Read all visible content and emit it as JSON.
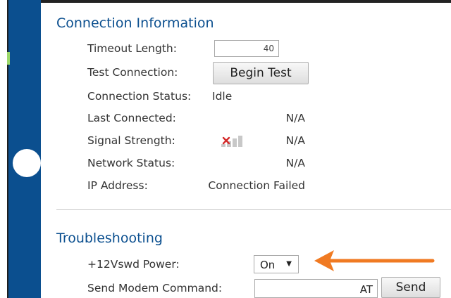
{
  "connection": {
    "title": "Connection Information",
    "timeout_label": "Timeout Length:",
    "timeout_value": "40",
    "test_label": "Test Connection:",
    "begin_test": "Begin Test",
    "status_label": "Connection Status:",
    "status_value": "Idle",
    "last_connected_label": "Last Connected:",
    "last_connected_value": "N/A",
    "signal_label": "Signal Strength:",
    "signal_value": "N/A",
    "signal_icon": "signal-none-icon",
    "network_label": "Network Status:",
    "network_value": "N/A",
    "ip_label": "IP Address:",
    "ip_value": "Connection Failed"
  },
  "troubleshooting": {
    "title": "Troubleshooting",
    "power_label": "+12Vswd Power:",
    "power_value": "On",
    "modem_label": "Send Modem Command:",
    "modem_value": "AT",
    "send": "Send"
  },
  "colors": {
    "accent": "#0b4f8f",
    "arrow": "#f07a22"
  }
}
